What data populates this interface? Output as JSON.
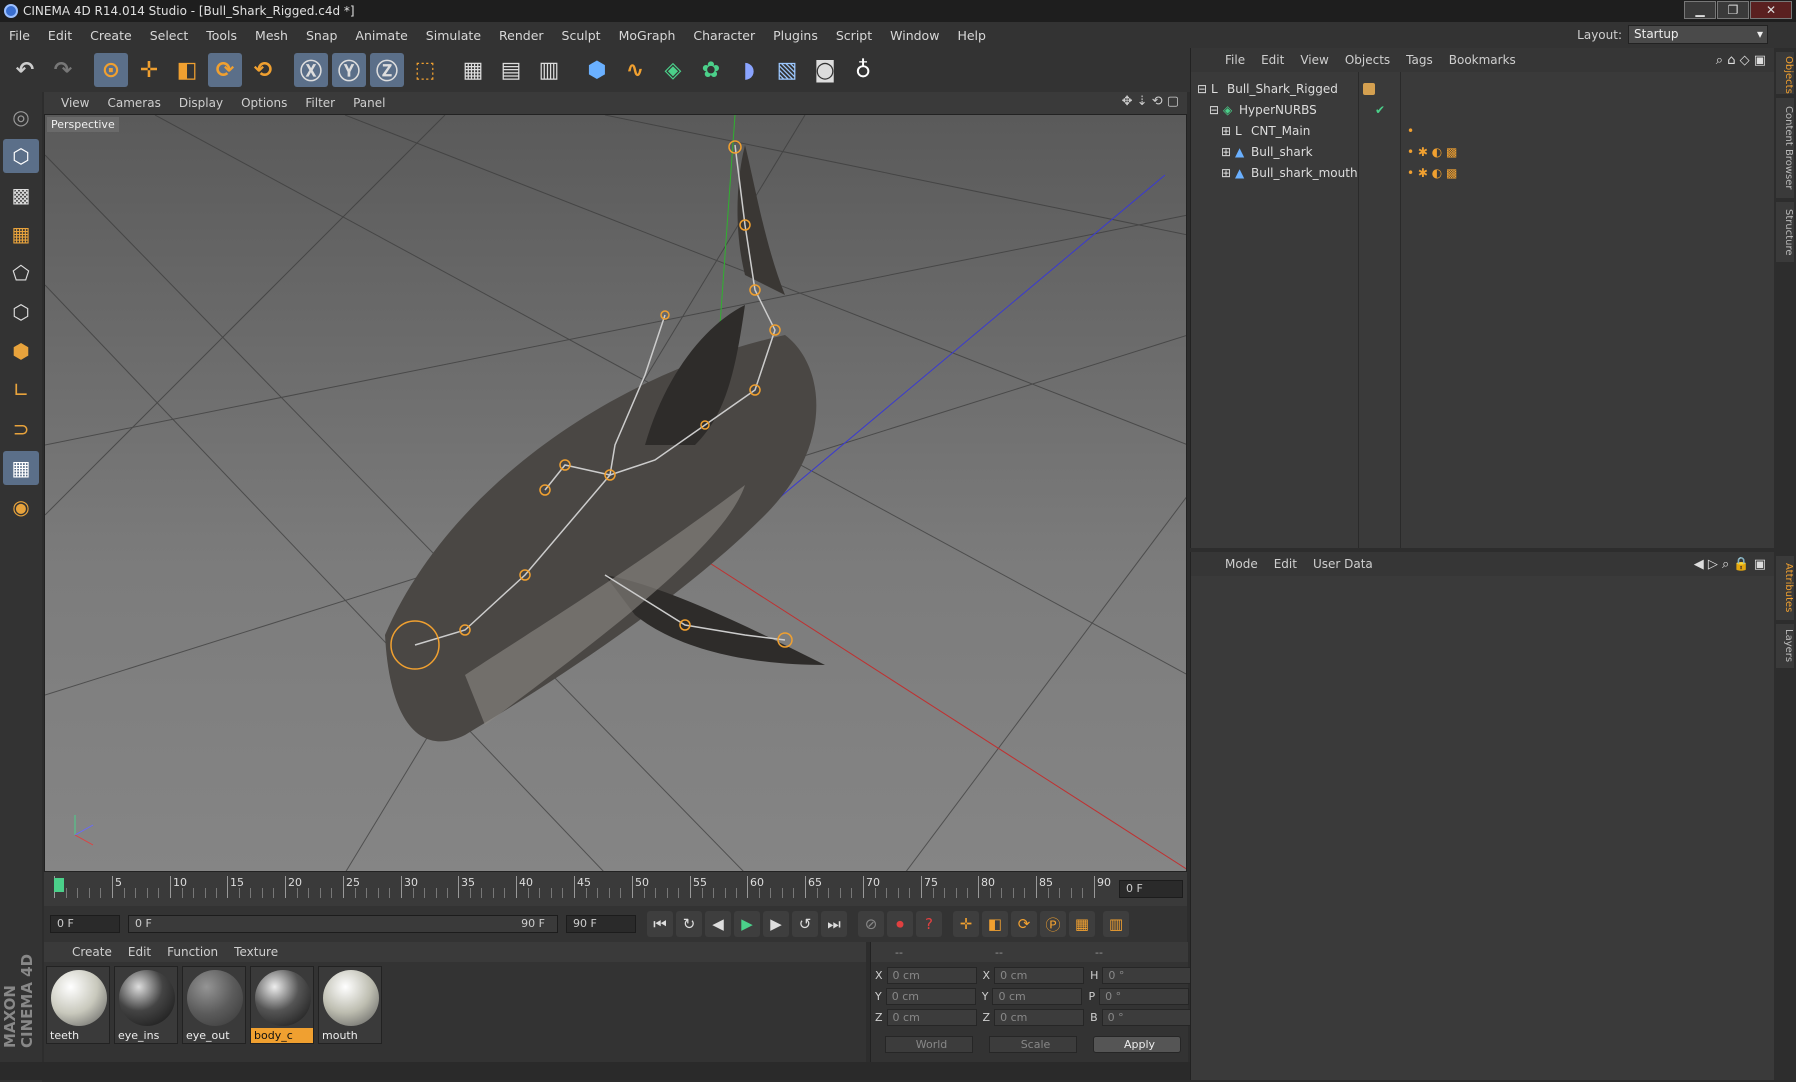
{
  "window": {
    "title": "CINEMA 4D R14.014 Studio - [Bull_Shark_Rigged.c4d *]"
  },
  "menu": [
    "File",
    "Edit",
    "Create",
    "Select",
    "Tools",
    "Mesh",
    "Snap",
    "Animate",
    "Simulate",
    "Render",
    "Sculpt",
    "MoGraph",
    "Character",
    "Plugins",
    "Script",
    "Window",
    "Help"
  ],
  "layout": {
    "label": "Layout:",
    "value": "Startup"
  },
  "viewport": {
    "menu": [
      "View",
      "Cameras",
      "Display",
      "Options",
      "Filter",
      "Panel"
    ],
    "label": "Perspective"
  },
  "timeline": {
    "ticks": [
      "0",
      "5",
      "10",
      "15",
      "20",
      "25",
      "30",
      "35",
      "40",
      "45",
      "50",
      "55",
      "60",
      "65",
      "70",
      "75",
      "80",
      "85",
      "90"
    ],
    "current": "0 F",
    "start": "0 F",
    "range_start": "0 F",
    "range_end": "90 F",
    "end": "90 F"
  },
  "materials": {
    "menu": [
      "Create",
      "Edit",
      "Function",
      "Texture"
    ],
    "items": [
      {
        "name": "teeth",
        "color": "#e8e8e0",
        "selected": false
      },
      {
        "name": "eye_ins",
        "color": "#555555",
        "selected": false
      },
      {
        "name": "eye_out",
        "color": "#8a8a8a",
        "selected": false
      },
      {
        "name": "body_c",
        "color": "#777777",
        "selected": true
      },
      {
        "name": "mouth",
        "color": "#d8d8cc",
        "selected": false
      }
    ]
  },
  "coords": {
    "headers": [
      "--",
      "--",
      "--"
    ],
    "rows": [
      {
        "a": "X",
        "av": "0 cm",
        "b": "X",
        "bv": "0 cm",
        "c": "H",
        "cv": "0 °"
      },
      {
        "a": "Y",
        "av": "0 cm",
        "b": "Y",
        "bv": "0 cm",
        "c": "P",
        "cv": "0 °"
      },
      {
        "a": "Z",
        "av": "0 cm",
        "b": "Z",
        "bv": "0 cm",
        "c": "B",
        "cv": "0 °"
      }
    ],
    "world": "World",
    "scale": "Scale",
    "apply": "Apply"
  },
  "objects": {
    "menu": [
      "File",
      "Edit",
      "View",
      "Objects",
      "Tags",
      "Bookmarks"
    ],
    "items": [
      {
        "name": "Bull_Shark_Rigged",
        "indent": 0
      },
      {
        "name": "HyperNURBS",
        "indent": 1
      },
      {
        "name": "CNT_Main",
        "indent": 2
      },
      {
        "name": "Bull_shark",
        "indent": 2
      },
      {
        "name": "Bull_shark_mouth",
        "indent": 2
      }
    ]
  },
  "attributes": {
    "menu": [
      "Mode",
      "Edit",
      "User Data"
    ]
  },
  "sidetabs": {
    "top": [
      "Objects",
      "Content Browser",
      "Structure"
    ],
    "bottom": [
      "Attributes",
      "Layers"
    ]
  },
  "logo": "MAXON CINEMA 4D"
}
